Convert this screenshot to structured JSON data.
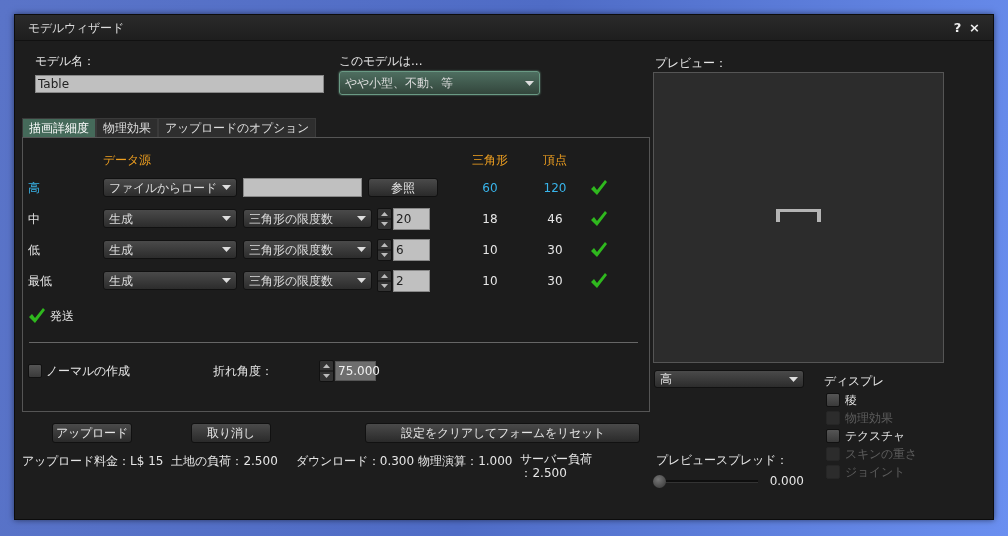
{
  "window": {
    "title": "モデルウィザード",
    "help": "?",
    "close": "×"
  },
  "model_name": {
    "label": "モデル名：",
    "value": "Table"
  },
  "model_type": {
    "label": "このモデルは...",
    "value": "やや小型、不動、等"
  },
  "tabs": [
    {
      "label": "描画詳細度",
      "selected": true
    },
    {
      "label": "物理効果",
      "selected": false
    },
    {
      "label": "アップロードのオプション",
      "selected": false
    }
  ],
  "lod": {
    "columns": [
      "データ源",
      "三角形",
      "頂点"
    ],
    "rows": [
      {
        "label": "高",
        "selected": true,
        "kind": "file",
        "source": "ファイルからロード",
        "browse": "参照",
        "triangles": "60",
        "vertices": "120",
        "ok": true
      },
      {
        "label": "中",
        "selected": false,
        "kind": "generate",
        "source": "生成",
        "method": "三角形の限度数",
        "limit": "20",
        "triangles": "18",
        "vertices": "46",
        "ok": true
      },
      {
        "label": "低",
        "selected": false,
        "kind": "generate",
        "source": "生成",
        "method": "三角形の限度数",
        "limit": "6",
        "triangles": "10",
        "vertices": "30",
        "ok": true
      },
      {
        "label": "最低",
        "selected": false,
        "kind": "generate",
        "source": "生成",
        "method": "三角形の限度数",
        "limit": "2",
        "triangles": "10",
        "vertices": "30",
        "ok": true
      }
    ]
  },
  "upload_status": {
    "label": "発送",
    "ok": true
  },
  "normals": {
    "label": "ノーマルの作成",
    "checked": false
  },
  "crease": {
    "label": "折れ角度：",
    "value": "75.000",
    "disabled": true
  },
  "buttons": [
    "アップロード",
    "取り消し",
    "設定をクリアしてフォームをリセット"
  ],
  "stats": [
    "アップロード料金：L$ 15",
    "土地の負荷：2.500",
    "ダウンロード：0.300",
    "物理演算：1.000",
    "サーバー負荷：2.500"
  ],
  "preview": {
    "label": "プレビュー：",
    "lod": "高",
    "display_label": "ディスプレ",
    "display": [
      {
        "label": "稜",
        "checked": false,
        "disabled": false
      },
      {
        "label": "物理効果",
        "checked": false,
        "disabled": true
      },
      {
        "label": "テクスチャ",
        "checked": false,
        "disabled": false
      },
      {
        "label": "スキンの重さ",
        "checked": false,
        "disabled": true
      },
      {
        "label": "ジョイント",
        "checked": false,
        "disabled": true
      }
    ],
    "spread": {
      "label": "プレビュースプレッド：",
      "level": 0,
      "reading": "0.000"
    }
  }
}
